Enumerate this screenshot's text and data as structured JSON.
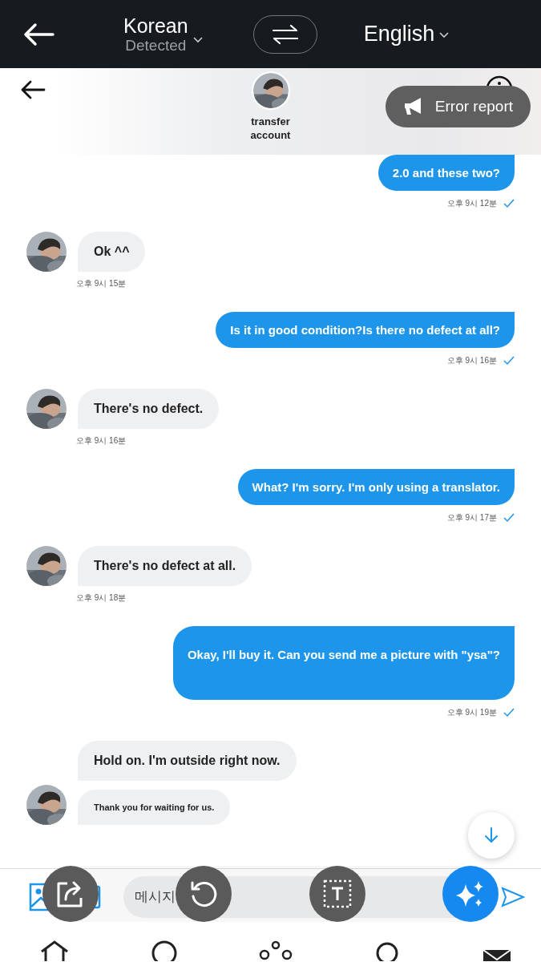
{
  "translator_bar": {
    "source_language": "Korean",
    "source_status": "Detected",
    "target_language": "English"
  },
  "chat_header": {
    "contact_name": "transfer account",
    "error_report": "Error report"
  },
  "messages": [
    {
      "kind": "sent",
      "text": "2.0 and these two?",
      "time": "오후 9시 12분",
      "read": true,
      "tall": false
    },
    {
      "kind": "received",
      "text": "Ok ^^",
      "time": "오후 9시 15분",
      "avatar": true,
      "small": false
    },
    {
      "kind": "sent",
      "text": "Is it in good condition?Is there no defect at all?",
      "time": "오후 9시 16분",
      "read": true,
      "tall": false
    },
    {
      "kind": "received",
      "text": "There's no defect.",
      "time": "오후 9시 16분",
      "avatar": true,
      "small": false
    },
    {
      "kind": "sent",
      "text": "What? I'm sorry. I'm only using a translator.",
      "time": "오후 9시 17분",
      "read": true,
      "tall": false
    },
    {
      "kind": "received",
      "text": "There's no defect at all.",
      "time": "오후 9시 18분",
      "avatar": true,
      "small": false
    },
    {
      "kind": "sent",
      "text": "Okay, I'll buy it. Can you send me a picture with \"ysa\"?",
      "time": "오후 9시 19분",
      "read": true,
      "tall": true
    },
    {
      "kind": "received",
      "text": "Hold on. I'm outside right now.",
      "avatar": false,
      "small": false
    },
    {
      "kind": "received",
      "text": "Thank you for waiting for us.",
      "avatar": true,
      "small": true
    }
  ],
  "composer": {
    "placeholder": "메시지"
  }
}
